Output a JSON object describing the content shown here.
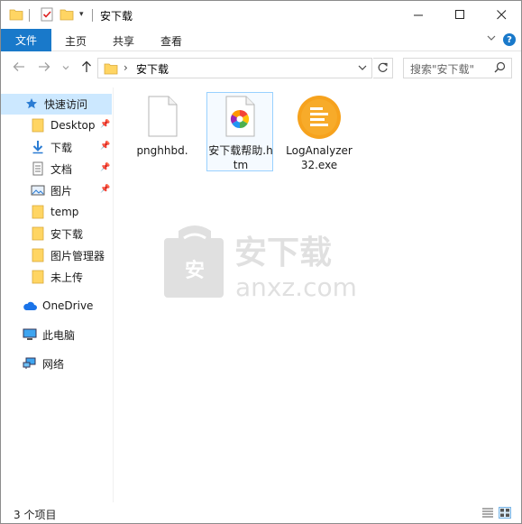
{
  "window": {
    "title": "安下载"
  },
  "titlebar": {
    "min_symbol": "—",
    "max_symbol": "☐",
    "close_symbol": "✕"
  },
  "ribbon": {
    "tabs": [
      {
        "label": "文件",
        "active": true
      },
      {
        "label": "主页"
      },
      {
        "label": "共享"
      },
      {
        "label": "查看"
      }
    ],
    "help_label": "?"
  },
  "address_bar": {
    "path_segments": [
      "安下载"
    ],
    "separator": "›"
  },
  "search": {
    "placeholder": "搜索\"安下载\""
  },
  "sidebar": {
    "quick_access": {
      "label": "快速访问",
      "icon": "star-icon"
    },
    "pinned_items": [
      {
        "label": "Desktop",
        "icon": "folder-icon",
        "pinned": true
      },
      {
        "label": "下载",
        "icon": "download-icon",
        "pinned": true
      },
      {
        "label": "文档",
        "icon": "document-icon",
        "pinned": true
      },
      {
        "label": "图片",
        "icon": "picture-icon",
        "pinned": true
      },
      {
        "label": "temp",
        "icon": "folder-icon",
        "pinned": false
      },
      {
        "label": "安下载",
        "icon": "folder-icon",
        "pinned": false
      },
      {
        "label": "图片管理器",
        "icon": "folder-icon",
        "pinned": false
      },
      {
        "label": "未上传",
        "icon": "folder-icon",
        "pinned": false
      }
    ],
    "onedrive": {
      "label": "OneDrive",
      "icon": "cloud-icon"
    },
    "this_pc": {
      "label": "此电脑",
      "icon": "computer-icon"
    },
    "network": {
      "label": "网络",
      "icon": "network-icon"
    }
  },
  "files": [
    {
      "name": "pnghhbd.",
      "icon": "blank-file-icon",
      "selected": false
    },
    {
      "name": "安下载帮助.htm",
      "icon": "html-file-icon",
      "selected": true
    },
    {
      "name": "LogAnalyzer32.exe",
      "icon": "log-analyzer-app-icon",
      "selected": false
    }
  ],
  "watermark": {
    "title": "安下载",
    "domain": "anxz.com",
    "badge_char": "安"
  },
  "status": {
    "item_count": "3 个项目"
  },
  "colors": {
    "accent": "#1979ca",
    "selection": "#cce8ff",
    "folder": "#ffd563",
    "app_orange": "#f6a21d"
  }
}
